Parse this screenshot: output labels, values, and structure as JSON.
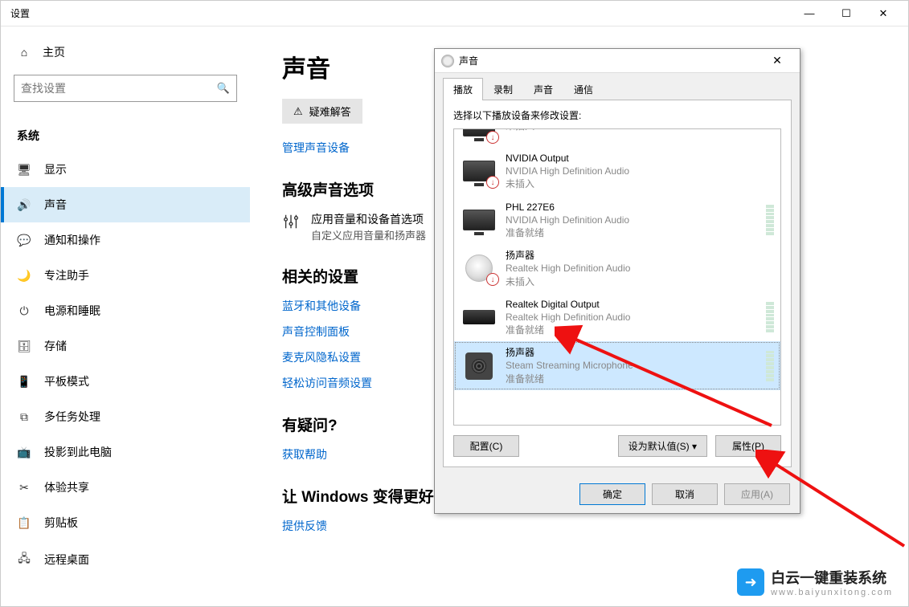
{
  "window": {
    "title": "设置",
    "minimize": "—",
    "maximize": "☐",
    "close": "✕"
  },
  "sidebar": {
    "home": "主页",
    "search_placeholder": "查找设置",
    "category": "系统",
    "items": [
      {
        "label": "显示",
        "icon": "🖥"
      },
      {
        "label": "声音",
        "icon": "🔊",
        "active": true
      },
      {
        "label": "通知和操作",
        "icon": "💬"
      },
      {
        "label": "专注助手",
        "icon": "🌙"
      },
      {
        "label": "电源和睡眠",
        "icon": "⏻"
      },
      {
        "label": "存储",
        "icon": "🗄"
      },
      {
        "label": "平板模式",
        "icon": "📱"
      },
      {
        "label": "多任务处理",
        "icon": "⧉"
      },
      {
        "label": "投影到此电脑",
        "icon": "📺"
      },
      {
        "label": "体验共享",
        "icon": "✂"
      },
      {
        "label": "剪贴板",
        "icon": "📋"
      },
      {
        "label": "远程桌面",
        "icon": "🖧"
      }
    ]
  },
  "content": {
    "title": "声音",
    "troubleshoot": "疑难解答",
    "manage_devices": "管理声音设备",
    "advanced_section": "高级声音选项",
    "app_volume_title": "应用音量和设备首选项",
    "app_volume_sub": "自定义应用音量和扬声器",
    "related_section": "相关的设置",
    "links": [
      "蓝牙和其他设备",
      "声音控制面板",
      "麦克风隐私设置",
      "轻松访问音频设置"
    ],
    "question_section": "有疑问?",
    "get_help": "获取帮助",
    "improve_section": "让 Windows 变得更好",
    "feedback": "提供反馈"
  },
  "dialog": {
    "title": "声音",
    "tabs": [
      "播放",
      "录制",
      "声音",
      "通信"
    ],
    "active_tab": 0,
    "instruction": "选择以下播放设备来修改设置:",
    "devices": [
      {
        "name": "",
        "sub": "",
        "status": "未插入",
        "icon": "monitor",
        "badge": true,
        "partial_top": true
      },
      {
        "name": "NVIDIA Output",
        "sub": "NVIDIA High Definition Audio",
        "status": "未插入",
        "icon": "monitor",
        "badge": true
      },
      {
        "name": "PHL 227E6",
        "sub": "NVIDIA High Definition Audio",
        "status": "准备就绪",
        "icon": "monitor",
        "badge": false,
        "level": true
      },
      {
        "name": "扬声器",
        "sub": "Realtek High Definition Audio",
        "status": "未插入",
        "icon": "speaker",
        "badge": true
      },
      {
        "name": "Realtek Digital Output",
        "sub": "Realtek High Definition Audio",
        "status": "准备就绪",
        "icon": "box",
        "badge": false,
        "level": true
      },
      {
        "name": "扬声器",
        "sub": "Steam Streaming Microphone",
        "status": "准备就绪",
        "icon": "boombox",
        "badge": false,
        "level": true,
        "selected": true
      }
    ],
    "buttons": {
      "configure": "配置(C)",
      "set_default": "设为默认值(S) ▾",
      "properties": "属性(P)",
      "ok": "确定",
      "cancel": "取消",
      "apply": "应用(A)"
    }
  },
  "watermark": {
    "text": "白云一键重装系统",
    "url": "www.baiyunxitong.com"
  }
}
